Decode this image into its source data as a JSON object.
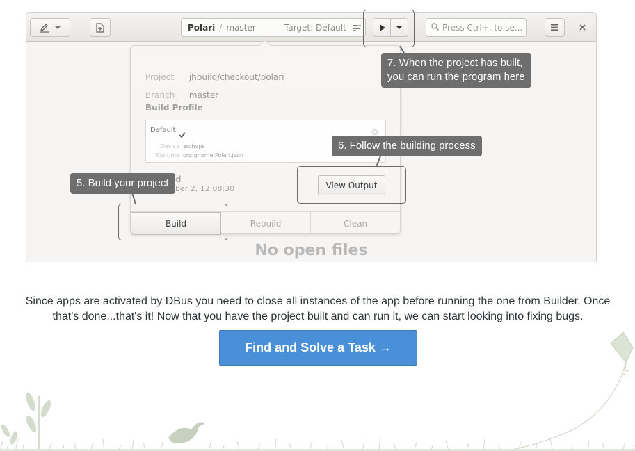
{
  "window": {
    "omnibar": {
      "project": "Polari",
      "separator": "/",
      "branch": "master",
      "target": "Target: Default"
    },
    "search_placeholder": "Press Ctrl+. to se..."
  },
  "popover": {
    "project_label": "Project",
    "project_value": "jhbuild/checkout/polari",
    "branch_label": "Branch",
    "branch_value": "master",
    "build_profile_title": "Build Profile",
    "profile": {
      "name": "Default",
      "device_label": "Device",
      "device_value": "archvps",
      "runtime_label": "Runtime",
      "runtime_value": "org.gnome.Polari.json"
    },
    "last_build_title": "d",
    "last_build_time": "ber 2, 12:08:30",
    "view_output_label": "View Output",
    "actions": [
      "Build",
      "Rebuild",
      "Clean"
    ]
  },
  "no_files_text": "No open files",
  "callouts": {
    "step5": "5. Build your project",
    "step6": "6. Follow the building process",
    "step7_line1": "7. When the project has built,",
    "step7_line2": "you can run the program here"
  },
  "intro": {
    "line1": "Since apps are activated by DBus you need to close all instances of the app before running the one from Builder. Once",
    "line2": "that's done...that's it! Now that you have the project built and can run it, we can start looking into fixing bugs."
  },
  "cta_label": "Find and Solve a Task →",
  "colors": {
    "accent": "#4a90d9",
    "callout": "#6e6e6e",
    "decor": "#c9d2c0"
  },
  "icons": [
    "pencil-icon",
    "chevron-down-icon",
    "new-document-icon",
    "build-log-icon",
    "play-icon",
    "search-icon",
    "menu-icon",
    "close-icon",
    "checkmark-icon",
    "gear-icon"
  ]
}
